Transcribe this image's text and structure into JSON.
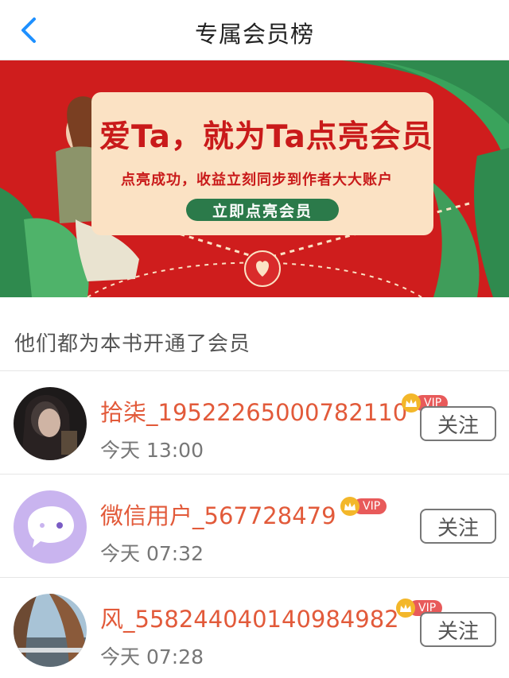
{
  "header": {
    "title": "专属会员榜",
    "back_icon": "chevron-left-icon"
  },
  "banner": {
    "headline": "爱Ta，就为Ta点亮会员",
    "subtitle": "点亮成功，收益立刻同步到作者大大账户",
    "cta_label": "立即点亮会员"
  },
  "section": {
    "title": "他们都为本书开通了会员"
  },
  "members": [
    {
      "name": "拾柒_19522265000782110",
      "time": "今天 13:00",
      "vip": "VIP",
      "follow_label": "关注"
    },
    {
      "name": "微信用户_567728479",
      "time": "今天 07:32",
      "vip": "VIP",
      "follow_label": "关注"
    },
    {
      "name": "风_55824404014098498​2",
      "time": "今天 07:28",
      "vip": "VIP",
      "follow_label": "关注"
    }
  ],
  "colors": {
    "accent_name": "#e25a3a",
    "banner_red": "#cf1d1d",
    "cta_green": "#2b7a4a",
    "back_blue": "#1e90ff"
  }
}
